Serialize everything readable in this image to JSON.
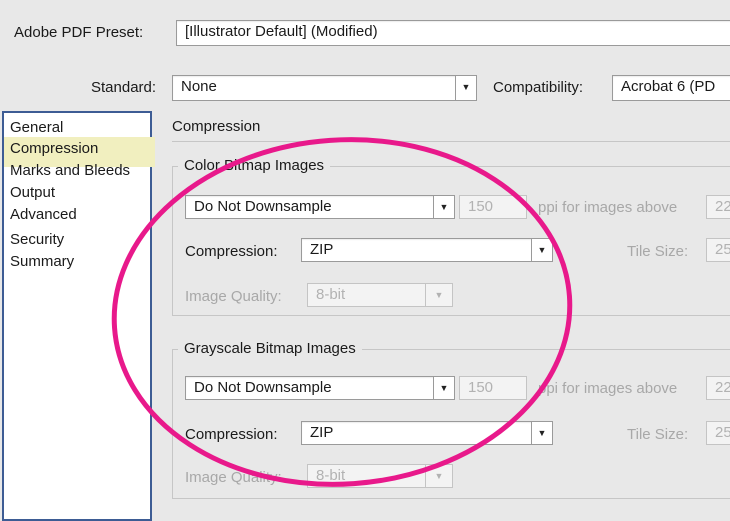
{
  "header": {
    "preset_label": "Adobe PDF Preset:",
    "preset_value": "[Illustrator Default] (Modified)",
    "standard_label": "Standard:",
    "standard_value": "None",
    "compatibility_label": "Compatibility:",
    "compatibility_value": "Acrobat 6 (PD"
  },
  "sidebar": {
    "items": [
      {
        "label": "General"
      },
      {
        "label": "Compression",
        "selected": true
      },
      {
        "label": "Marks and Bleeds"
      },
      {
        "label": "Output"
      },
      {
        "label": "Advanced"
      },
      {
        "label": "Security"
      },
      {
        "label": "Summary"
      }
    ]
  },
  "main": {
    "section_title": "Compression",
    "color_group": {
      "legend": "Color Bitmap Images",
      "downsample": "Do Not Downsample",
      "ppi_value": "150",
      "ppi_label": "ppi for images above",
      "ppi_above_value": "22",
      "compression_label": "Compression:",
      "compression_value": "ZIP",
      "tile_label": "Tile Size:",
      "tile_value": "25",
      "quality_label": "Image Quality:",
      "quality_value": "8-bit"
    },
    "gray_group": {
      "legend": "Grayscale Bitmap Images",
      "downsample": "Do Not Downsample",
      "ppi_value": "150",
      "ppi_label": "ppi for images above",
      "ppi_above_value": "22",
      "compression_label": "Compression:",
      "compression_value": "ZIP",
      "tile_label": "Tile Size:",
      "tile_value": "25",
      "quality_label": "Image Quality:",
      "quality_value": "8-bit"
    }
  },
  "icons": {
    "dropdown": "chevron-down-icon",
    "annotation": "highlight-ellipse"
  },
  "colors": {
    "annotation_ellipse": "#e8198b",
    "selected_item_bg": "#f1efbf",
    "sidebar_border": "#3d5c94"
  }
}
